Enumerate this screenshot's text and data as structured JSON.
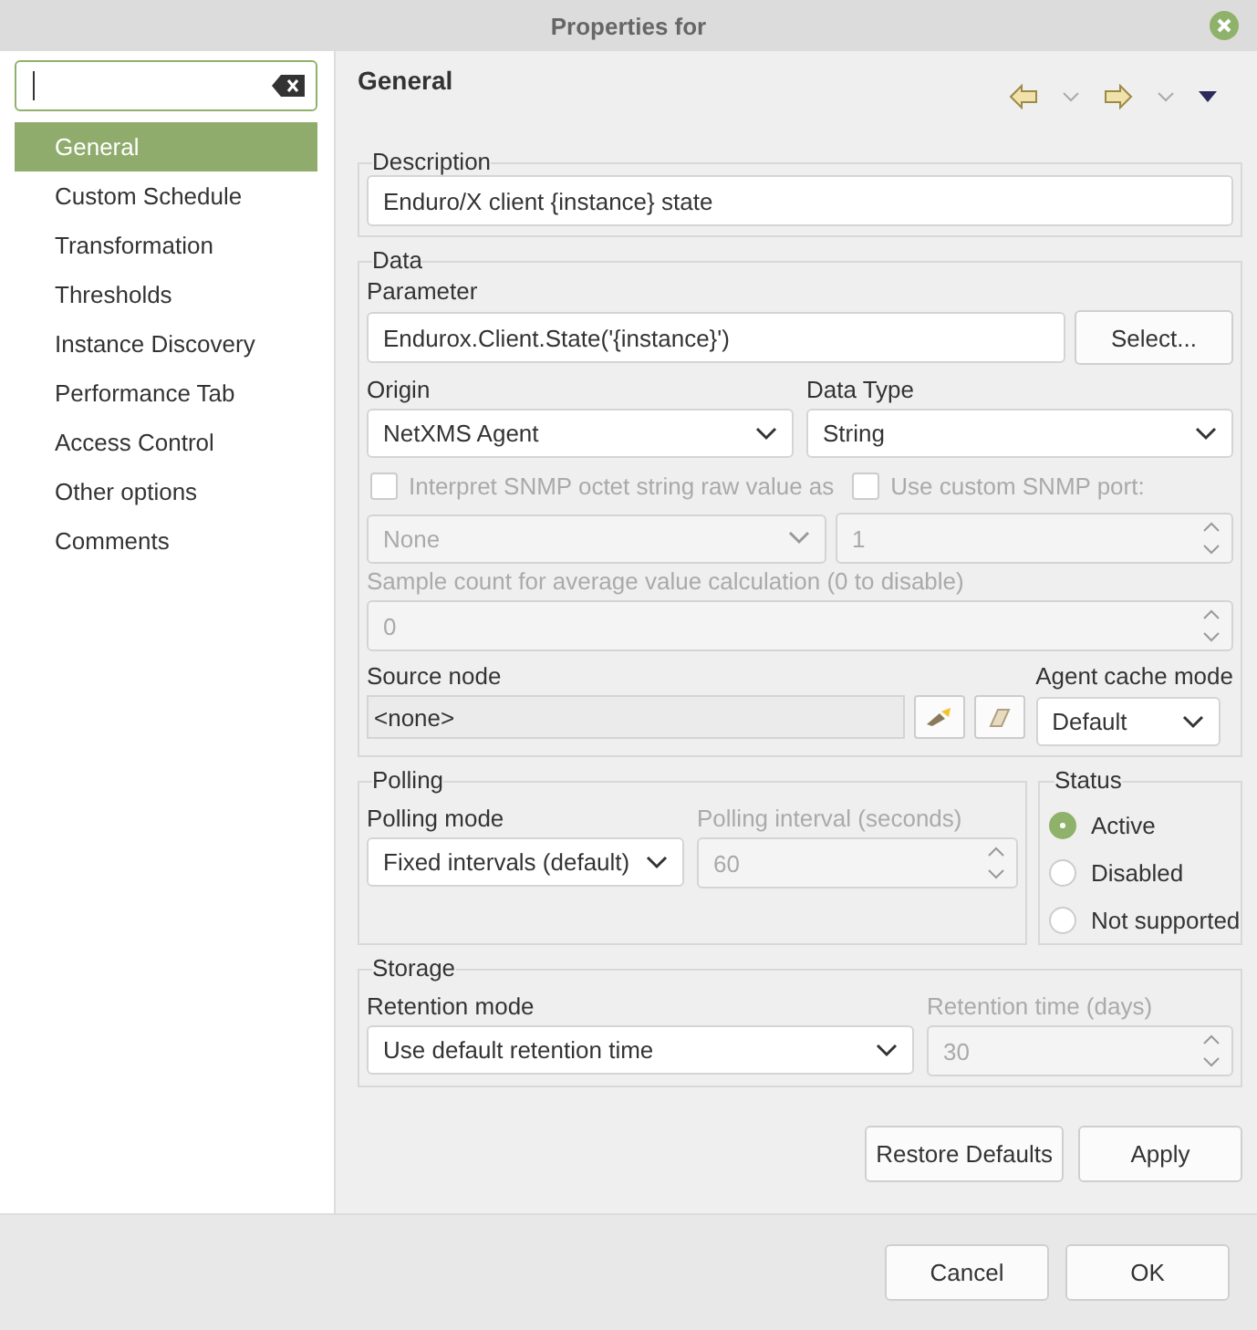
{
  "window": {
    "title": "Properties for"
  },
  "sidebar": {
    "items": [
      {
        "label": "General",
        "selected": true
      },
      {
        "label": "Custom Schedule",
        "selected": false
      },
      {
        "label": "Transformation",
        "selected": false
      },
      {
        "label": "Thresholds",
        "selected": false
      },
      {
        "label": "Instance Discovery",
        "selected": false
      },
      {
        "label": "Performance Tab",
        "selected": false
      },
      {
        "label": "Access Control",
        "selected": false
      },
      {
        "label": "Other options",
        "selected": false
      },
      {
        "label": "Comments",
        "selected": false
      }
    ]
  },
  "page": {
    "title": "General"
  },
  "description": {
    "label": "Description",
    "value": "Enduro/X client {instance} state"
  },
  "data": {
    "label": "Data",
    "parameter": {
      "label": "Parameter",
      "value": "Endurox.Client.State('{instance}')",
      "button": "Select..."
    },
    "origin": {
      "label": "Origin",
      "value": "NetXMS Agent"
    },
    "data_type": {
      "label": "Data Type",
      "value": "String"
    },
    "snmp_raw": {
      "label": "Interpret SNMP octet string raw value as",
      "checked": false,
      "disabled": true
    },
    "snmp_port": {
      "label": "Use custom SNMP port:",
      "checked": false,
      "disabled": true
    },
    "raw_format": {
      "value": "None",
      "disabled": true
    },
    "port": {
      "value": "1",
      "disabled": true
    },
    "sample_count": {
      "label": "Sample count for average value calculation (0 to disable)",
      "value": "0",
      "disabled": true
    },
    "source_node": {
      "label": "Source node",
      "value": "<none>"
    },
    "cache_mode": {
      "label": "Agent cache mode",
      "value": "Default"
    }
  },
  "polling": {
    "label": "Polling",
    "mode": {
      "label": "Polling mode",
      "value": "Fixed intervals (default)"
    },
    "interval": {
      "label": "Polling interval (seconds)",
      "value": "60",
      "disabled": true
    }
  },
  "status": {
    "label": "Status",
    "options": [
      {
        "label": "Active",
        "selected": true
      },
      {
        "label": "Disabled",
        "selected": false
      },
      {
        "label": "Not supported",
        "selected": false
      }
    ]
  },
  "storage": {
    "label": "Storage",
    "mode": {
      "label": "Retention mode",
      "value": "Use default retention time"
    },
    "time": {
      "label": "Retention time (days)",
      "value": "30",
      "disabled": true
    }
  },
  "page_buttons": [
    "Restore Defaults",
    "Apply"
  ],
  "dialog_buttons": [
    "Cancel",
    "OK"
  ]
}
